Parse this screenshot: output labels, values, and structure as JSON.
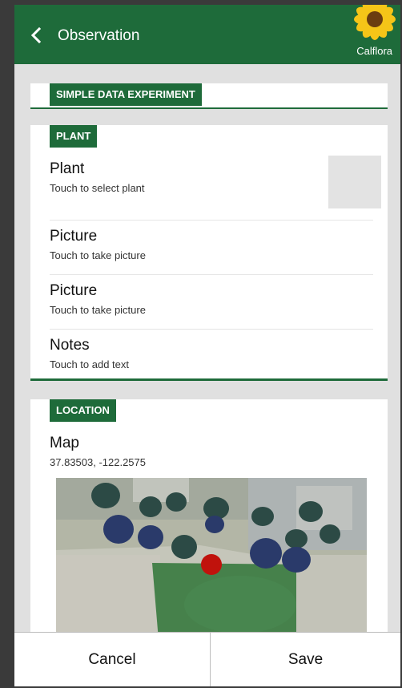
{
  "appbar": {
    "title": "Observation",
    "logo_text": "Calflora"
  },
  "experiment": {
    "header": "SIMPLE DATA EXPERIMENT"
  },
  "plant_section": {
    "header": "PLANT",
    "rows": [
      {
        "title": "Plant",
        "subtitle": "Touch to select plant"
      },
      {
        "title": "Picture",
        "subtitle": "Touch to take picture"
      },
      {
        "title": "Picture",
        "subtitle": "Touch to take picture"
      },
      {
        "title": "Notes",
        "subtitle": "Touch to add text"
      }
    ]
  },
  "location_section": {
    "header": "LOCATION",
    "map_title": "Map",
    "coordinates": "37.83503, -122.2575"
  },
  "actions": {
    "cancel": "Cancel",
    "save": "Save"
  },
  "colors": {
    "primary": "#1e6b3a",
    "marker": "#c0120c",
    "background": "#e0e0e0"
  },
  "icons": {
    "back": "back-arrow-icon",
    "logo": "sunflower-icon",
    "marker": "location-marker-icon"
  }
}
